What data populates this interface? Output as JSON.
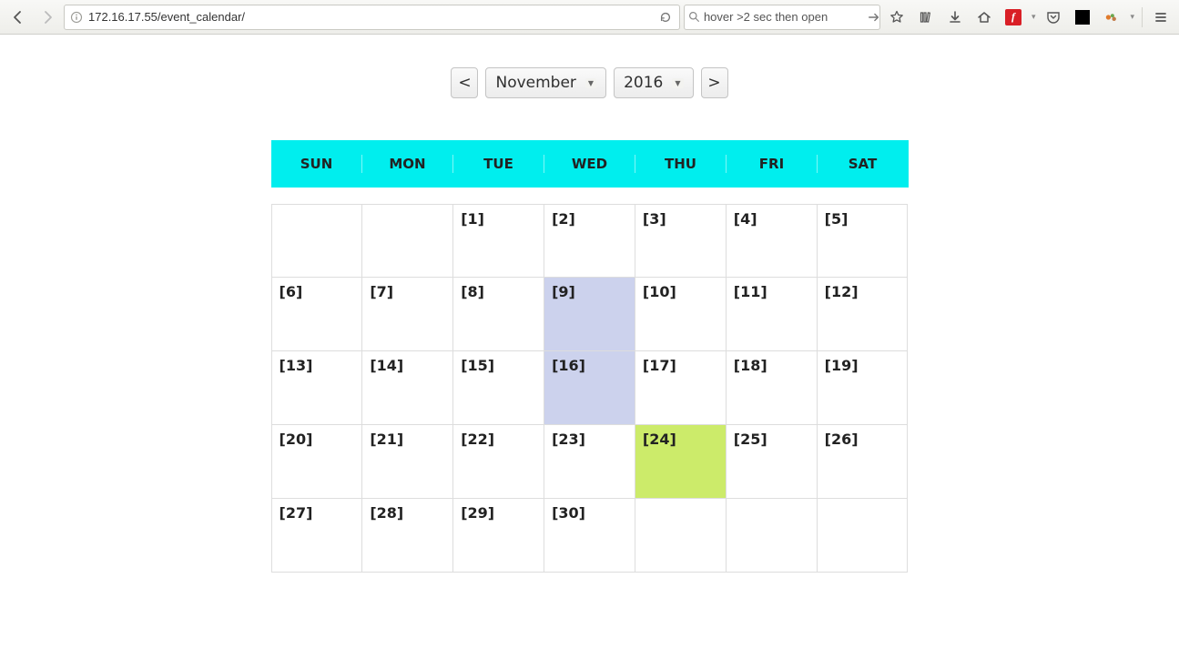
{
  "browser": {
    "url": "172.16.17.55/event_calendar/",
    "search_value": "hover >2 sec then open"
  },
  "nav": {
    "prev": "<",
    "next": ">",
    "month": "November",
    "year": "2016"
  },
  "day_headers": [
    "SUN",
    "MON",
    "TUE",
    "WED",
    "THU",
    "FRI",
    "SAT"
  ],
  "weeks": [
    [
      {
        "label": ""
      },
      {
        "label": ""
      },
      {
        "label": "[1]"
      },
      {
        "label": "[2]"
      },
      {
        "label": "[3]"
      },
      {
        "label": "[4]"
      },
      {
        "label": "[5]"
      }
    ],
    [
      {
        "label": "[6]"
      },
      {
        "label": "[7]"
      },
      {
        "label": "[8]"
      },
      {
        "label": "[9]",
        "highlight": "blue"
      },
      {
        "label": "[10]"
      },
      {
        "label": "[11]"
      },
      {
        "label": "[12]"
      }
    ],
    [
      {
        "label": "[13]"
      },
      {
        "label": "[14]"
      },
      {
        "label": "[15]"
      },
      {
        "label": "[16]",
        "highlight": "blue"
      },
      {
        "label": "[17]"
      },
      {
        "label": "[18]"
      },
      {
        "label": "[19]"
      }
    ],
    [
      {
        "label": "[20]"
      },
      {
        "label": "[21]"
      },
      {
        "label": "[22]"
      },
      {
        "label": "[23]"
      },
      {
        "label": "[24]",
        "highlight": "green"
      },
      {
        "label": "[25]"
      },
      {
        "label": "[26]"
      }
    ],
    [
      {
        "label": "[27]"
      },
      {
        "label": "[28]"
      },
      {
        "label": "[29]"
      },
      {
        "label": "[30]"
      },
      {
        "label": ""
      },
      {
        "label": ""
      },
      {
        "label": ""
      }
    ]
  ]
}
